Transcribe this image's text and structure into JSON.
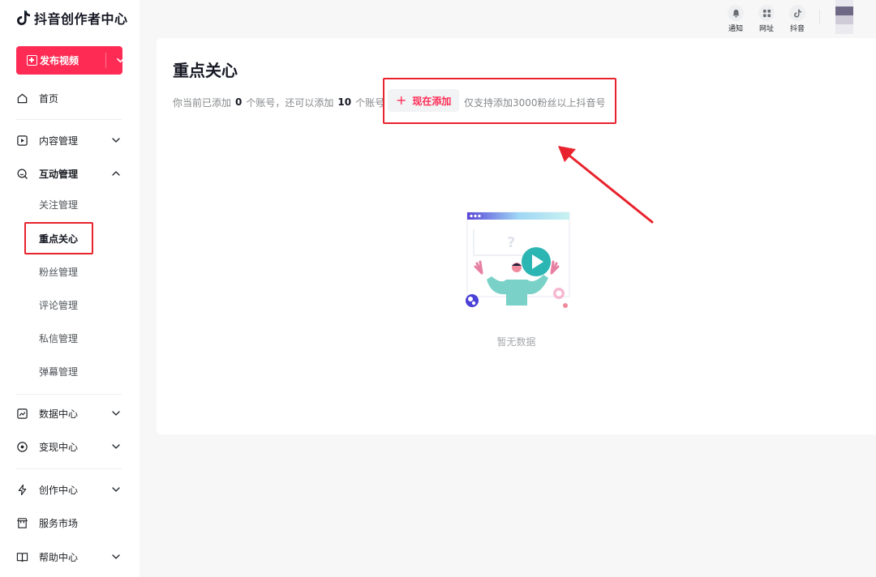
{
  "app": {
    "title": "抖音创作者中心"
  },
  "sidebar": {
    "publish_label": "发布视频",
    "items": [
      {
        "label": "首页"
      },
      {
        "label": "内容管理"
      },
      {
        "label": "互动管理"
      },
      {
        "label": "数据中心"
      },
      {
        "label": "变现中心"
      },
      {
        "label": "创作中心"
      },
      {
        "label": "服务市场"
      },
      {
        "label": "帮助中心"
      }
    ],
    "sub_items": [
      {
        "label": "关注管理"
      },
      {
        "label": "重点关心"
      },
      {
        "label": "粉丝管理"
      },
      {
        "label": "评论管理"
      },
      {
        "label": "私信管理"
      },
      {
        "label": "弹幕管理"
      }
    ]
  },
  "header": {
    "icons": [
      {
        "label": "通知",
        "icon": "bell-icon"
      },
      {
        "label": "网址",
        "icon": "grid-icon"
      },
      {
        "label": "抖音",
        "icon": "douyin-icon"
      }
    ]
  },
  "main": {
    "title": "重点关心",
    "info_prefix": "你当前已添加",
    "added_count": "0",
    "info_middle": "个账号，还可以添加",
    "remaining_count": "10",
    "info_suffix": "个账号",
    "add_button": "现在添加",
    "note": "仅支持添加3000粉丝以上抖音号",
    "empty_text": "暂无数据"
  },
  "colors": {
    "brand": "#fe2c55",
    "annotation": "#e8232d"
  }
}
